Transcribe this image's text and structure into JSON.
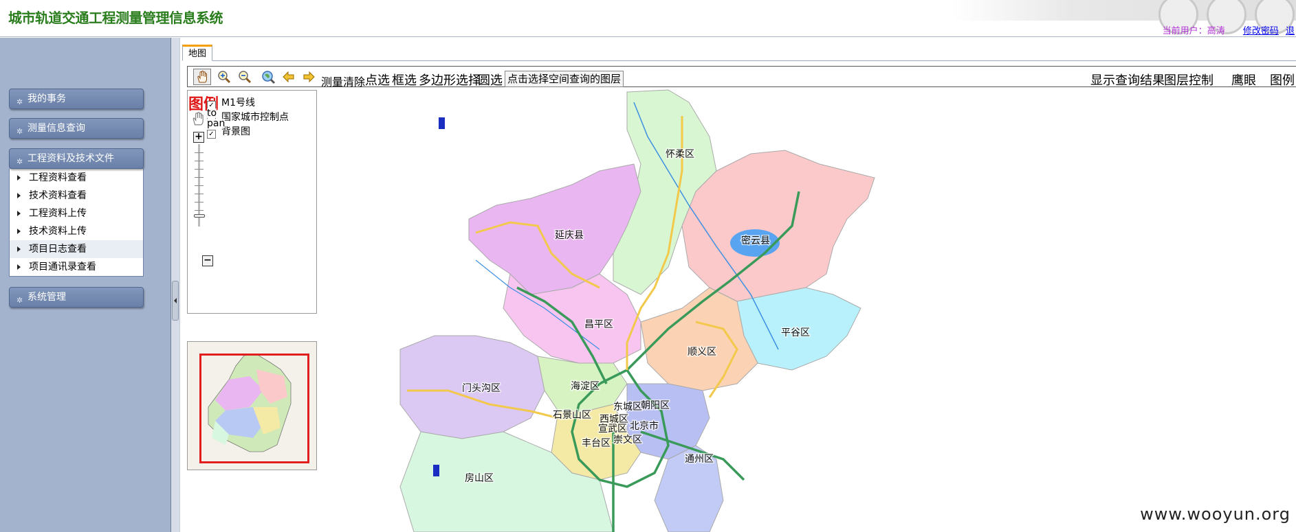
{
  "header": {
    "title": "城市轨道交通工程测量管理信息系统",
    "user_label": "当前用户：",
    "user_name": "高涛",
    "change_password": "修改密码",
    "logout": "退"
  },
  "sidebar": {
    "sections": [
      {
        "label": "我的事务"
      },
      {
        "label": "测量信息查询"
      },
      {
        "label": "工程资料及技术文件",
        "items": [
          "工程资料查看",
          "技术资料查看",
          "工程资料上传",
          "技术资料上传",
          "项目日志查看",
          "项目通讯录查看"
        ]
      },
      {
        "label": "系统管理"
      }
    ]
  },
  "tabs": [
    {
      "label": "地图"
    }
  ],
  "toolbar": {
    "icons": [
      "pan-hand-icon",
      "zoom-in-icon",
      "zoom-out-icon",
      "full-extent-icon",
      "back-arrow-icon",
      "forward-arrow-icon"
    ],
    "measure": "测量",
    "clear": "清除",
    "point_select": "点选",
    "box_select": "框选",
    "polygon_select": "多边形选择",
    "circle_select": "圆选",
    "layer_select": "点击选择空间查询的图层",
    "show_results": "显示查询结果",
    "layer_control": "图层控制",
    "eagle_eye": "鹰眼",
    "legend": "图例"
  },
  "legend_panel": {
    "title": "图例",
    "pan_tooltip_1": "to",
    "pan_tooltip_2": "pan",
    "rows": [
      {
        "label": "M1号线",
        "checked": true
      },
      {
        "label": "国家城市控制点",
        "checked": false
      },
      {
        "label": "背景图",
        "checked": true
      }
    ]
  },
  "map": {
    "districts": [
      "怀柔区",
      "密云县",
      "延庆县",
      "昌平区",
      "平谷区",
      "顺义区",
      "海淀区",
      "门头沟区",
      "石景山区",
      "东城区",
      "朝阳区",
      "西城区",
      "宣武区",
      "北京市",
      "丰台区",
      "崇文区",
      "通州区",
      "房山区"
    ],
    "watermark": "www.wooyun.org"
  },
  "colors": {
    "title_green": "#2a7d1d",
    "sidebar_bg": "#a3b3cd",
    "legend_red": "#e01818",
    "user_purple": "#b233d6"
  }
}
